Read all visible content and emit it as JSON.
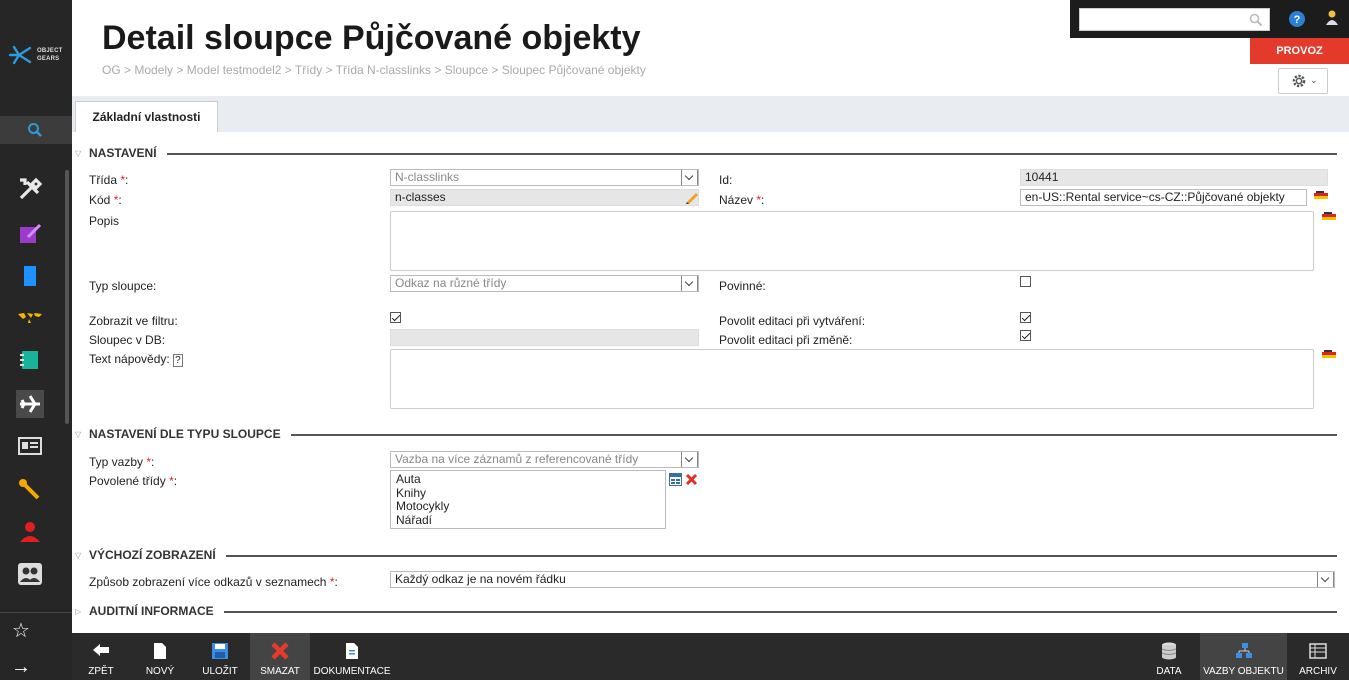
{
  "app": {
    "logo_line1": "OBJECT",
    "logo_line2": "GEARS"
  },
  "header": {
    "title": "Detail sloupce Půjčované objekty",
    "breadcrumb": "OG > Modely > Model testmodel2 > Třídy > Třída N-classlinks > Sloupce > Sloupec Půjčované objekty",
    "search_placeholder": "",
    "env_label": "PROVOZ"
  },
  "tabs": [
    {
      "label": "Základní vlastnosti",
      "active": true
    }
  ],
  "sections": {
    "nastaveni": "NASTAVENÍ",
    "dle_typu": "NASTAVENÍ DLE TYPU SLOUPCE",
    "vychozi": "VÝCHOZÍ ZOBRAZENÍ",
    "auditni": "AUDITNÍ INFORMACE"
  },
  "fields": {
    "trida": {
      "label": "Třída",
      "req": "*",
      "value": "N-classlinks"
    },
    "kod": {
      "label": "Kód",
      "req": "*",
      "value": "n-classes"
    },
    "popis": {
      "label": "Popis",
      "value": ""
    },
    "typ_sloupce": {
      "label": "Typ sloupce:",
      "value": "Odkaz na různé třídy"
    },
    "zobrazit_filtr": {
      "label": "Zobrazit ve filtru:",
      "checked": true
    },
    "sloupec_db": {
      "label": "Sloupec v DB:",
      "value": ""
    },
    "text_napovedy": {
      "label": "Text nápovědy:",
      "value": ""
    },
    "id": {
      "label": "Id:",
      "value": "10441"
    },
    "nazev": {
      "label": "Název",
      "req": "*",
      "value": "en-US::Rental service~cs-CZ::Půjčované objekty"
    },
    "povinne": {
      "label": "Povinné:",
      "checked": false
    },
    "edit_vytvareni": {
      "label": "Povolit editaci při vytváření:",
      "checked": true
    },
    "edit_zmene": {
      "label": "Povolit editaci při změně:",
      "checked": true
    },
    "typ_vazby": {
      "label": "Typ vazby",
      "req": "*",
      "value": "Vazba na více záznamů z referencované třídy"
    },
    "povolene_tridy": {
      "label": "Povolené třídy",
      "req": "*",
      "items": [
        "Auta",
        "Knihy",
        "Motocykly",
        "Nářadí"
      ]
    },
    "zpusob_zobrazeni": {
      "label": "Způsob zobrazení více odkazů v seznamech",
      "req": "*",
      "value": "Každý odkaz je na novém řádku"
    }
  },
  "footer": {
    "left": [
      "ZPĚT",
      "NOVÝ",
      "ULOŽIT",
      "SMAZAT",
      "DOKUMENTACE"
    ],
    "right": [
      "DATA",
      "VAZBY OBJEKTU",
      "ARCHIV"
    ]
  },
  "colors": {
    "accent_red": "#e33a2b",
    "sidebar": "#262626",
    "tab_bg": "#e9edf2"
  }
}
